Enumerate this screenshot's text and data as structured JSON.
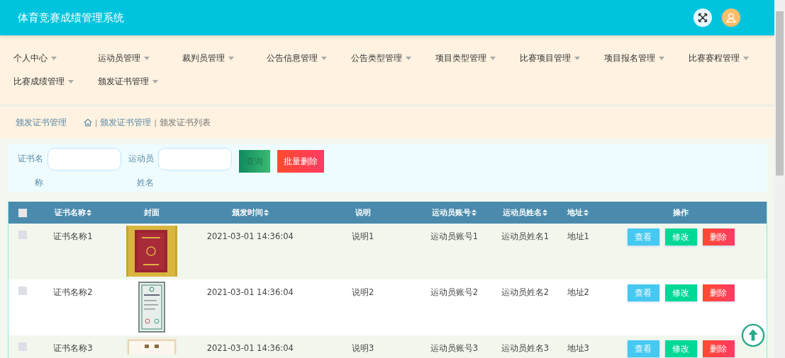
{
  "header": {
    "title": "体育竞赛成绩管理系统"
  },
  "nav": [
    {
      "label": "个人中心"
    },
    {
      "label": "运动员管理"
    },
    {
      "label": "裁判员管理"
    },
    {
      "label": "公告信息管理"
    },
    {
      "label": "公告类型管理"
    },
    {
      "label": "项目类型管理"
    },
    {
      "label": "比赛项目管理"
    },
    {
      "label": "项目报名管理"
    },
    {
      "label": "比赛赛程管理"
    },
    {
      "label": "比赛成绩管理"
    },
    {
      "label": "颁发证书管理"
    }
  ],
  "breadcrumb": {
    "title": "颁发证书管理",
    "path": [
      {
        "separator": "|",
        "label": "颁发证书管理"
      },
      {
        "separator": "|",
        "label": "颁发证书列表"
      }
    ]
  },
  "search": {
    "fields": [
      {
        "label": "证书名称"
      },
      {
        "label": "运动员姓名"
      }
    ],
    "query_button": "查询",
    "batch_delete_button": "批量删除"
  },
  "table": {
    "select_all_checked": false,
    "columns": [
      {
        "label": "证书名称",
        "sortable": true
      },
      {
        "label": "封面",
        "sortable": false
      },
      {
        "label": "颁发时间",
        "sortable": true
      },
      {
        "label": "说明",
        "sortable": false
      },
      {
        "label": "运动员账号",
        "sortable": true
      },
      {
        "label": "运动员姓名",
        "sortable": true
      },
      {
        "label": "地址",
        "sortable": true
      },
      {
        "label": "操作",
        "sortable": false
      }
    ],
    "rows": [
      {
        "checked": false,
        "name": "证书名称1",
        "time": "2021-03-01 14:36:04",
        "note": "说明1",
        "account": "运动员账号1",
        "athlete": "运动员姓名1",
        "address": "地址1",
        "actions": [
          "查看",
          "修改",
          "删除"
        ]
      },
      {
        "checked": false,
        "name": "证书名称2",
        "time": "2021-03-01 14:36:04",
        "note": "说明2",
        "account": "运动员账号2",
        "athlete": "运动员姓名2",
        "address": "地址2",
        "actions": [
          "查看",
          "修改",
          "删除"
        ]
      },
      {
        "checked": false,
        "name": "证书名称3",
        "time": "2021-03-01 14:36:04",
        "note": "说明3",
        "account": "运动员账号3",
        "athlete": "运动员姓名3",
        "address": "地址3",
        "actions": [
          "查看",
          "修改",
          "删除"
        ]
      }
    ]
  }
}
